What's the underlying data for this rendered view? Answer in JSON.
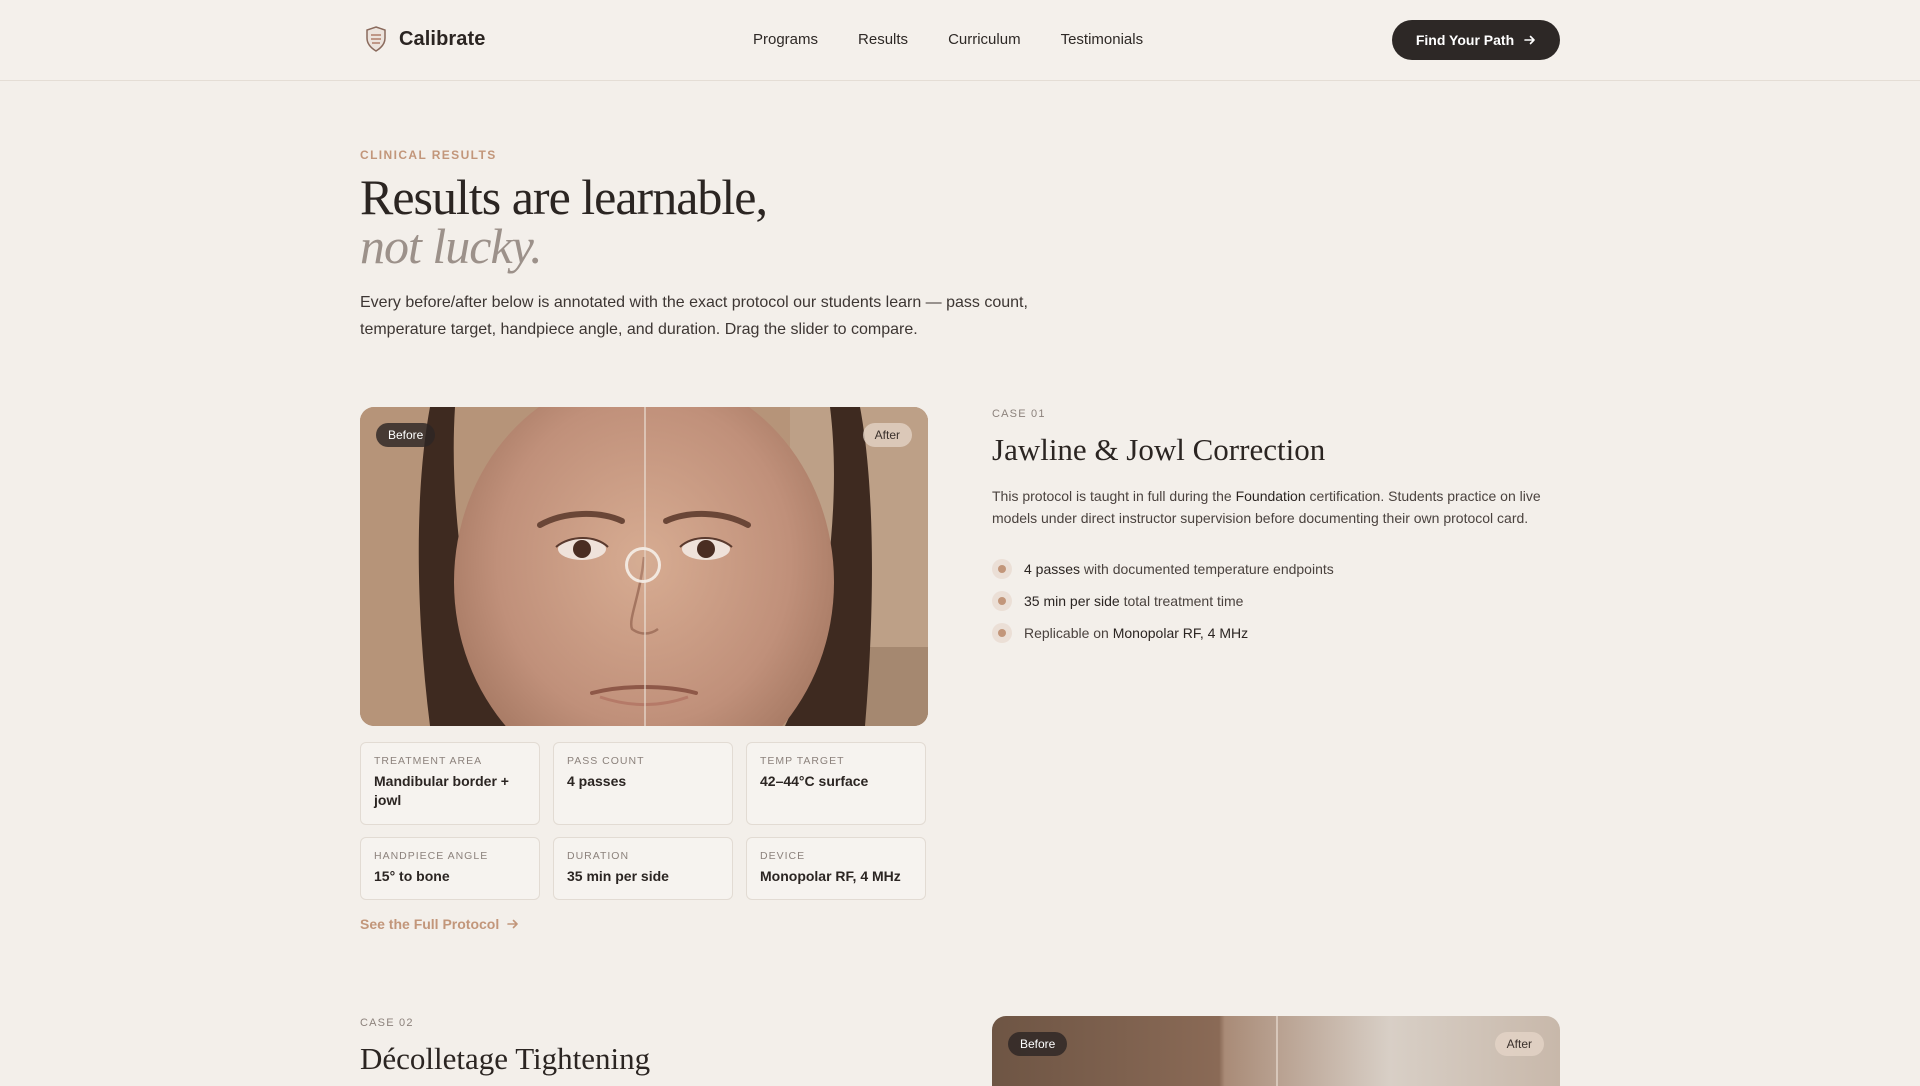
{
  "nav": {
    "brand": "Calibrate",
    "links": [
      "Programs",
      "Results",
      "Curriculum",
      "Testimonials"
    ],
    "cta": "Find Your Path"
  },
  "hero": {
    "eyebrow": "CLINICAL RESULTS",
    "title": "Results are learnable,",
    "title_em": "not lucky.",
    "lede": "Every before/after below is annotated with the exact protocol our students learn — pass count, temperature target, handpiece angle, and duration. Drag the slider to compare."
  },
  "case1": {
    "label": "CASE 01",
    "title": "Jawline & Jowl Correction",
    "before": "Before",
    "after": "After",
    "desc_pre": "This protocol is taught in full during the ",
    "desc_bold": "Foundation",
    "desc_post": " certification. Students practice on live models under direct instructor supervision before documenting their own protocol card.",
    "bullets": [
      {
        "strong": "4 passes",
        "rest": " with documented temperature endpoints"
      },
      {
        "strong": "35 min per side",
        "rest": " total treatment time"
      },
      {
        "pre": "Replicable on ",
        "strong": "Monopolar RF, 4 MHz"
      }
    ],
    "stats": [
      {
        "label": "TREATMENT AREA",
        "value": "Mandibular border + jowl"
      },
      {
        "label": "PASS COUNT",
        "value": "4 passes"
      },
      {
        "label": "TEMP TARGET",
        "value": "42–44°C surface"
      },
      {
        "label": "HANDPIECE ANGLE",
        "value": "15° to bone"
      },
      {
        "label": "DURATION",
        "value": "35 min per side"
      },
      {
        "label": "DEVICE",
        "value": "Monopolar RF, 4 MHz"
      }
    ],
    "protocol_link": "See the Full Protocol",
    "slider_position": 0.5
  },
  "case2": {
    "label": "CASE 02",
    "title": "Décolletage Tightening",
    "before": "Before",
    "after": "After"
  },
  "icons": {
    "brand": "shield-logo-icon",
    "cta_arrow": "arrow-right-icon",
    "link_arrow": "arrow-right-icon"
  },
  "colors": {
    "background": "#f3efea",
    "accent": "#c2967a",
    "dark": "#2d2826"
  }
}
